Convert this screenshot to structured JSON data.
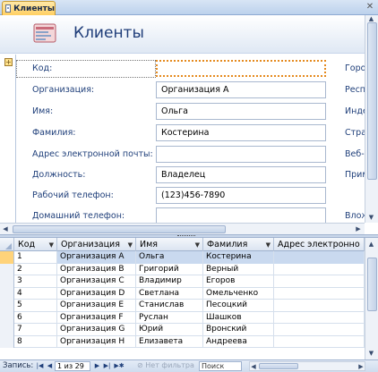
{
  "tab": {
    "label": "Клиенты",
    "icon": "form-icon"
  },
  "form": {
    "title": "Клиенты",
    "fields": [
      {
        "label": "Код:",
        "value": ""
      },
      {
        "label": "Организация:",
        "value": "Организация A"
      },
      {
        "label": "Имя:",
        "value": "Ольга"
      },
      {
        "label": "Фамилия:",
        "value": "Костерина"
      },
      {
        "label": "Адрес электронной почты:",
        "value": ""
      },
      {
        "label": "Должность:",
        "value": "Владелец"
      },
      {
        "label": "Рабочий телефон:",
        "value": "(123)456-7890"
      },
      {
        "label": "Домашний телефон:",
        "value": ""
      }
    ],
    "right_labels": [
      "Горо",
      "Респ",
      "Инде",
      "Стра",
      "Веб-",
      "Прим",
      "Влож"
    ]
  },
  "sheet": {
    "columns": [
      "Код",
      "Организация",
      "Имя",
      "Фамилия",
      "Адрес электронно"
    ],
    "rows": [
      [
        "1",
        "Организация A",
        "Ольга",
        "Костерина",
        ""
      ],
      [
        "2",
        "Организация B",
        "Григорий",
        "Верный",
        ""
      ],
      [
        "3",
        "Организация C",
        "Владимир",
        "Егоров",
        ""
      ],
      [
        "4",
        "Организация D",
        "Светлана",
        "Омельченко",
        ""
      ],
      [
        "5",
        "Организация E",
        "Станислав",
        "Песоцкий",
        ""
      ],
      [
        "6",
        "Организация F",
        "Руслан",
        "Шашков",
        ""
      ],
      [
        "7",
        "Организация G",
        "Юрий",
        "Вронский",
        ""
      ],
      [
        "8",
        "Организация H",
        "Елизавета",
        "Андреева",
        ""
      ]
    ]
  },
  "nav": {
    "label": "Запись:",
    "position": "1 из 29",
    "filter": "Нет фильтра",
    "search_placeholder": "Поиск"
  },
  "colors": {
    "accent": "#1e3c78",
    "tab_active": "#ffcf62",
    "focus": "#e58a1e"
  }
}
